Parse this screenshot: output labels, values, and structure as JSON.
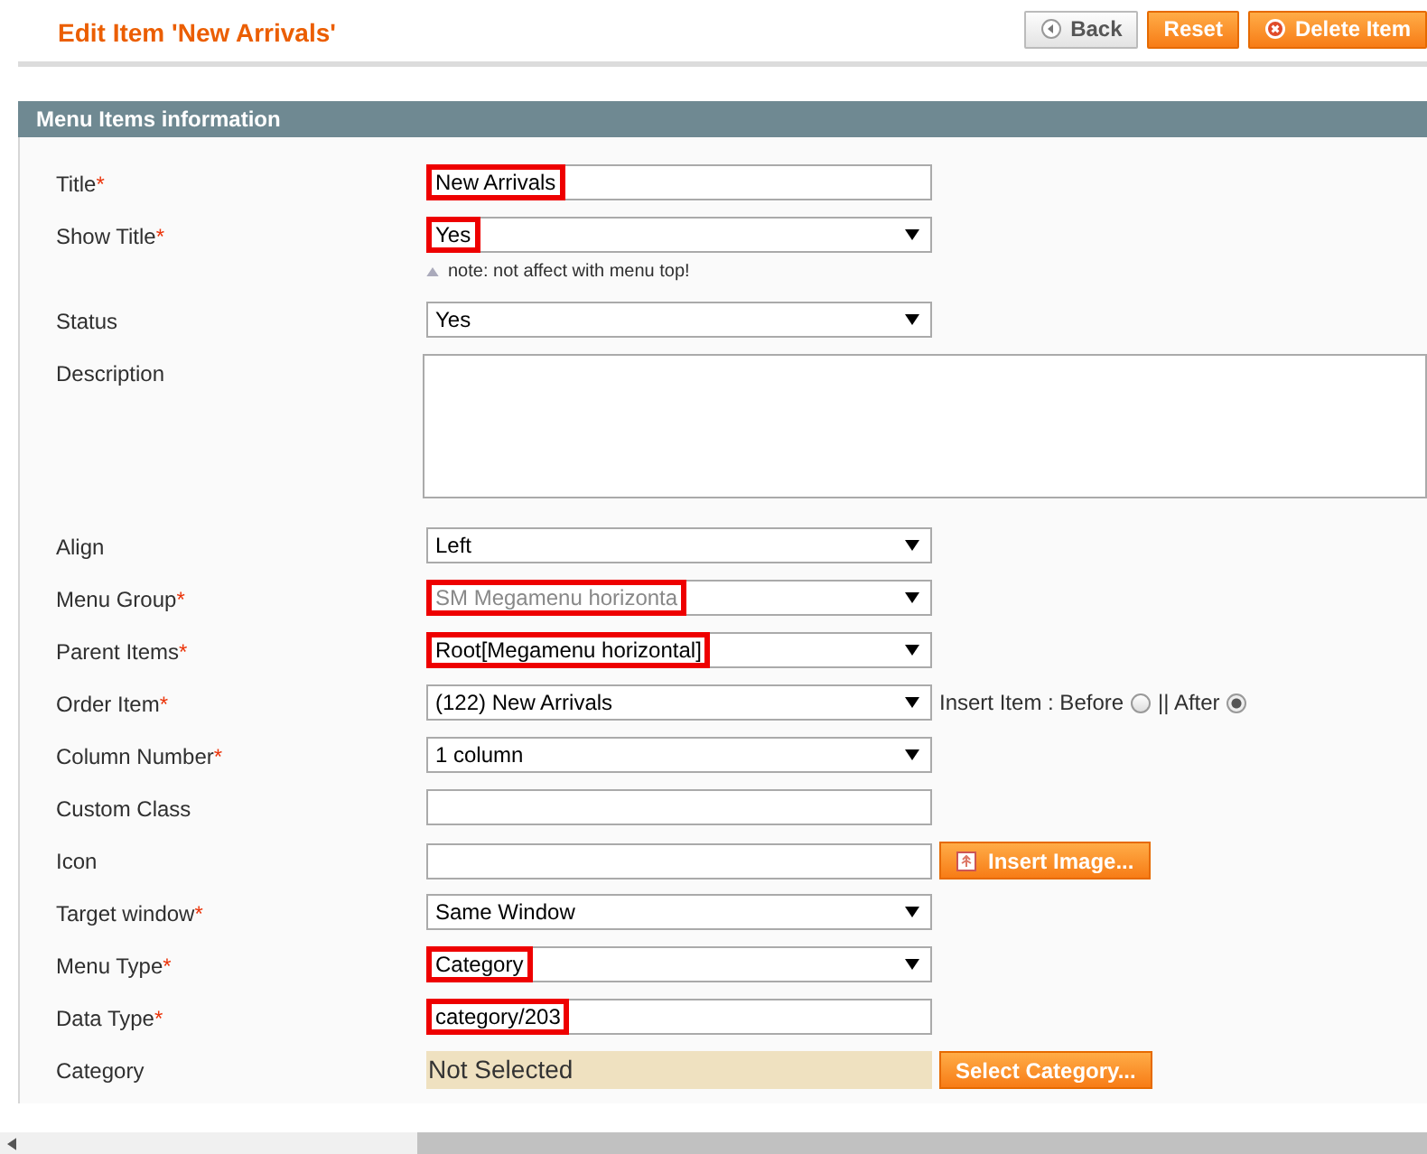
{
  "page_title": "Edit Item 'New Arrivals'",
  "header_buttons": [
    {
      "label": "Back",
      "kind": "back"
    },
    {
      "label": "Reset",
      "kind": "plain"
    },
    {
      "label": "Delete Item",
      "kind": "delete"
    }
  ],
  "section_title": "Menu Items information",
  "fields": [
    {
      "label": "Title",
      "required_mark": "*",
      "kind": "text",
      "value": "New Arrivals",
      "highlighted": true
    },
    {
      "label": "Show Title",
      "required_mark": "*",
      "kind": "select",
      "value": "Yes",
      "highlighted": true,
      "note": "note: not affect with menu top!"
    },
    {
      "label": "Status",
      "kind": "select",
      "value": "Yes"
    },
    {
      "label": "Description",
      "kind": "textarea"
    },
    {
      "label": "Align",
      "kind": "select",
      "value": "Left"
    },
    {
      "label": "Menu Group",
      "required_mark": "*",
      "kind": "select",
      "value": "SM Megamenu horizonta",
      "highlighted": true,
      "disabled": true
    },
    {
      "label": "Parent Items",
      "required_mark": "*",
      "kind": "select",
      "value": "Root[Megamenu horizontal]",
      "highlighted": true
    },
    {
      "label": "Order Item",
      "required_mark": "*",
      "kind": "select",
      "value": "(122) New Arrivals",
      "radios": [
        {
          "label": "Insert Item : Before",
          "selected": false
        },
        {
          "label": "|| After",
          "selected": true
        }
      ]
    },
    {
      "label": "Column Number",
      "required_mark": "*",
      "kind": "select",
      "value": "1 column"
    },
    {
      "label": "Custom Class",
      "kind": "text"
    },
    {
      "label": "Icon",
      "kind": "text",
      "button": "Insert Image..."
    },
    {
      "label": "Target window",
      "required_mark": "*",
      "kind": "select",
      "value": "Same Window"
    },
    {
      "label": "Menu Type",
      "required_mark": "*",
      "kind": "select",
      "value": "Category",
      "highlighted": true
    },
    {
      "label": "Data Type",
      "required_mark": "*",
      "kind": "text",
      "value": "category/203",
      "highlighted": true
    },
    {
      "label": "Category",
      "kind": "static",
      "value": "Not Selected",
      "button": "Select Category..."
    }
  ]
}
